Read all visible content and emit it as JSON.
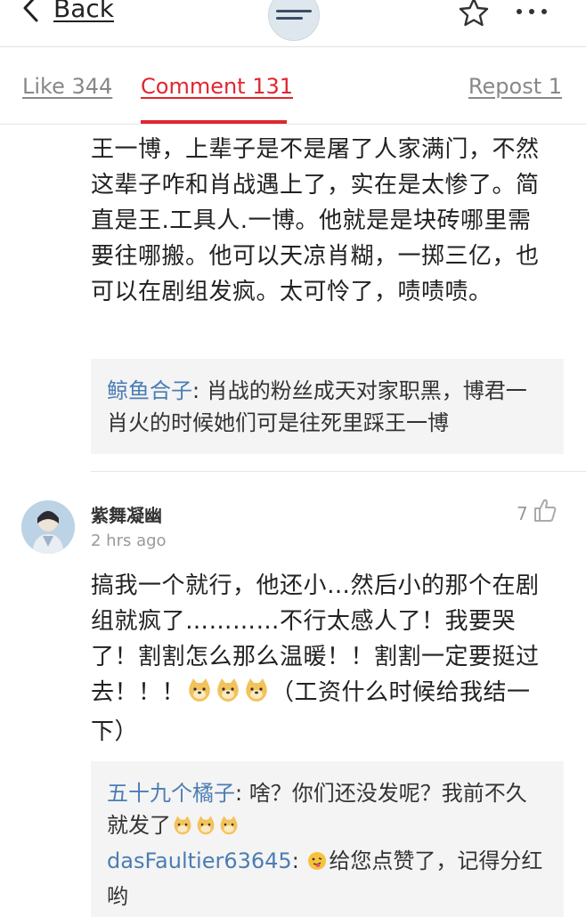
{
  "header": {
    "back_label": "Back"
  },
  "tabs": {
    "like": "Like 344",
    "comment": "Comment 131",
    "repost": "Repost 1",
    "accent_color": "#e0272f"
  },
  "comments": [
    {
      "text": "王一博，上辈子是不是屠了人家满门，不然这辈子咋和肖战遇上了，实在是太惨了。简直是王.工具人.一博。他就是是块砖哪里需要往哪搬。他可以天凉肖糊，一掷三亿，也可以在剧组发疯。太可怜了，啧啧啧。",
      "replies": [
        {
          "name": "鲸鱼合子",
          "text": ": 肖战的粉丝成天对家职黑，博君一肖火的时候她们可是往死里踩王一博"
        }
      ]
    },
    {
      "username": "紫舞凝幽",
      "time": "2 hrs ago",
      "likes": "7",
      "text_before_emoji": "搞我一个就行，他还小…然后小的那个在剧组就疯了…………不行太感人了！我要哭了！割割怎么那么温暖！！割割一定要挺过去！！！",
      "text_after_emoji": "（工资什么时候给我结一下）",
      "replies": [
        {
          "name": "五十九个橘子",
          "text": ": 啥？你们还没发呢？我前不久就发了"
        },
        {
          "name": "dasFaultier63645",
          "text": "给您点赞了，记得分红哟"
        }
      ]
    }
  ],
  "icons": {
    "back": "chevron-left-icon",
    "star": "star-icon",
    "more": "more-dots-icon",
    "like": "thumbs-up-icon",
    "doge": "doge-emoji-icon",
    "tongue": "tongue-face-emoji-icon"
  },
  "colors": {
    "link_blue": "#4b7db4",
    "muted": "#999999"
  }
}
